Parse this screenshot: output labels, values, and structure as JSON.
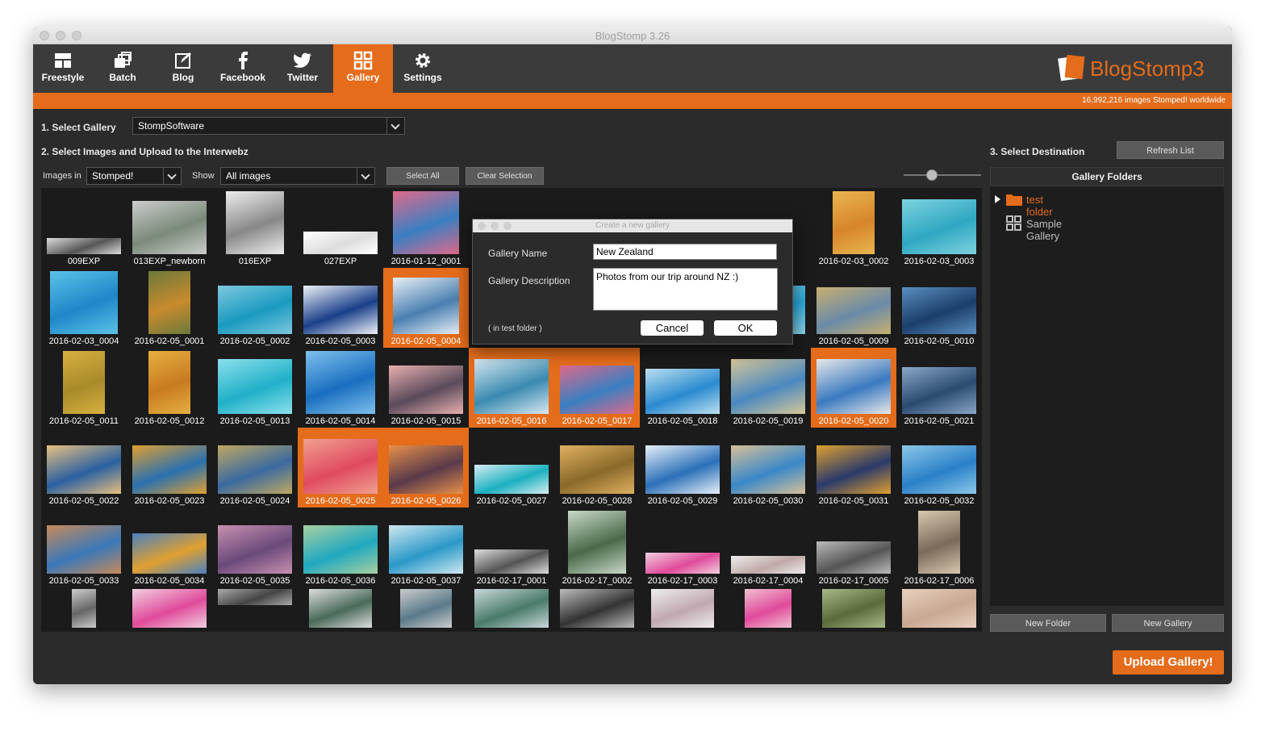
{
  "window": {
    "title": "BlogStomp 3.26"
  },
  "toolbar": {
    "items": [
      {
        "label": "Freestyle",
        "icon": "freestyle-icon"
      },
      {
        "label": "Batch",
        "icon": "batch-icon"
      },
      {
        "label": "Blog",
        "icon": "blog-icon"
      },
      {
        "label": "Facebook",
        "icon": "facebook-icon"
      },
      {
        "label": "Twitter",
        "icon": "twitter-icon"
      },
      {
        "label": "Gallery",
        "icon": "gallery-icon"
      },
      {
        "label": "Settings",
        "icon": "gear-icon"
      }
    ],
    "active": "Gallery",
    "brand": "BlogStomp3"
  },
  "status": {
    "counter": "16,992,216 images Stomped! worldwide"
  },
  "step1": {
    "label": "1. Select Gallery",
    "value": "StompSoftware"
  },
  "step2": {
    "label": "2. Select Images and Upload to the Interwebz",
    "images_in_label": "Images in",
    "images_in_value": "Stomped!",
    "show_label": "Show",
    "show_value": "All images",
    "select_all": "Select All",
    "clear_selection": "Clear Selection"
  },
  "step3": {
    "label": "3. Select Destination",
    "refresh": "Refresh List",
    "panel_title": "Gallery Folders",
    "folders": [
      {
        "name": "test folder",
        "type": "folder",
        "color": "#e46c1a"
      },
      {
        "name": "Sample Gallery",
        "type": "gallery",
        "color": "#bdbdbd"
      }
    ],
    "new_folder": "New Folder",
    "new_gallery": "New Gallery",
    "upload": "Upload Gallery!"
  },
  "thumbnails": [
    {
      "name": "009EXP",
      "selected": false,
      "colors": [
        "#555",
        "#ddd"
      ]
    },
    {
      "name": "013EXP_newborn",
      "selected": false,
      "colors": [
        "#7a8a7a",
        "#ccc"
      ]
    },
    {
      "name": "016EXP",
      "selected": false,
      "colors": [
        "#888",
        "#eee"
      ]
    },
    {
      "name": "027EXP",
      "selected": false,
      "colors": [
        "#ddd",
        "#fff"
      ]
    },
    {
      "name": "2016-01-12_0001",
      "selected": false,
      "colors": [
        "#3a7fc2",
        "#e06a8a"
      ]
    },
    {
      "name": "",
      "selected": false,
      "colors": [
        "#8ab6d8",
        "#e9eef2"
      ]
    },
    {
      "name": "",
      "selected": false,
      "colors": [
        "#2d5d8f",
        "#b8cde0"
      ]
    },
    {
      "name": "",
      "selected": false,
      "colors": [
        "#3f6f99",
        "#d0dbe5"
      ]
    },
    {
      "name": "",
      "selected": false,
      "colors": [
        "#d6a653",
        "#8ba05a"
      ]
    },
    {
      "name": "2016-02-03_0002",
      "selected": false,
      "colors": [
        "#d7852b",
        "#e9b550"
      ]
    },
    {
      "name": "2016-02-03_0003",
      "selected": false,
      "colors": [
        "#2fa7c2",
        "#7ed3df"
      ]
    },
    {
      "name": "2016-02-03_0004",
      "selected": false,
      "colors": [
        "#1f86c9",
        "#5bc3e8"
      ]
    },
    {
      "name": "2016-02-05_0001",
      "selected": false,
      "colors": [
        "#c88a2e",
        "#6b7a3a"
      ]
    },
    {
      "name": "2016-02-05_0002",
      "selected": false,
      "colors": [
        "#1a9ac0",
        "#7ec8de"
      ]
    },
    {
      "name": "2016-02-05_0003",
      "selected": false,
      "colors": [
        "#1a3f8a",
        "#eef2f8"
      ]
    },
    {
      "name": "2016-02-05_0004",
      "selected": true,
      "colors": [
        "#4a7fb0",
        "#e9f0f6"
      ]
    },
    {
      "name": "",
      "selected": false,
      "colors": [
        "#20a0c8",
        "#a8dce8"
      ]
    },
    {
      "name": "",
      "selected": false,
      "colors": [
        "#333",
        "#777"
      ]
    },
    {
      "name": "",
      "selected": false,
      "colors": [
        "#333",
        "#777"
      ]
    },
    {
      "name": "",
      "selected": false,
      "colors": [
        "#2ba8d8",
        "#8cd4e8"
      ]
    },
    {
      "name": "2016-02-05_0009",
      "selected": false,
      "colors": [
        "#6a8aa8",
        "#c8b070"
      ]
    },
    {
      "name": "2016-02-05_0010",
      "selected": false,
      "colors": [
        "#1c3e6a",
        "#5a8fc0"
      ]
    },
    {
      "name": "2016-02-05_0011",
      "selected": false,
      "colors": [
        "#a88a2a",
        "#d8b040"
      ]
    },
    {
      "name": "2016-02-05_0012",
      "selected": false,
      "colors": [
        "#c87a20",
        "#e6b040"
      ]
    },
    {
      "name": "2016-02-05_0013",
      "selected": false,
      "colors": [
        "#20b0c8",
        "#8ce0ec"
      ]
    },
    {
      "name": "2016-02-05_0014",
      "selected": false,
      "colors": [
        "#1a6ec0",
        "#7ec0ec"
      ]
    },
    {
      "name": "2016-02-05_0015",
      "selected": false,
      "colors": [
        "#5a4a5a",
        "#e8b0b0"
      ]
    },
    {
      "name": "2016-02-05_0016",
      "selected": true,
      "colors": [
        "#3a8ab0",
        "#d8e8f0"
      ]
    },
    {
      "name": "2016-02-05_0017",
      "selected": true,
      "colors": [
        "#3a7fc2",
        "#e06a8a"
      ]
    },
    {
      "name": "2016-02-05_0018",
      "selected": false,
      "colors": [
        "#2a8ad0",
        "#bce0f0"
      ]
    },
    {
      "name": "2016-02-05_0019",
      "selected": false,
      "colors": [
        "#4a88c0",
        "#d8c898"
      ]
    },
    {
      "name": "2016-02-05_0020",
      "selected": true,
      "colors": [
        "#3a7ac0",
        "#e8e8e8"
      ]
    },
    {
      "name": "2016-02-05_0021",
      "selected": false,
      "colors": [
        "#2a4a70",
        "#8aa8c8"
      ]
    },
    {
      "name": "2016-02-05_0022",
      "selected": false,
      "colors": [
        "#2a60a0",
        "#e8c080"
      ]
    },
    {
      "name": "2016-02-05_0023",
      "selected": false,
      "colors": [
        "#2a70b0",
        "#e0a030"
      ]
    },
    {
      "name": "2016-02-05_0024",
      "selected": false,
      "colors": [
        "#3a6aa0",
        "#c0a860"
      ]
    },
    {
      "name": "2016-02-05_0025",
      "selected": true,
      "colors": [
        "#e04a60",
        "#f0a090"
      ]
    },
    {
      "name": "2016-02-05_0026",
      "selected": true,
      "colors": [
        "#5a3a4a",
        "#e8904a"
      ]
    },
    {
      "name": "2016-02-05_0027",
      "selected": false,
      "colors": [
        "#1ab0c0",
        "#d8eef2"
      ]
    },
    {
      "name": "2016-02-05_0028",
      "selected": false,
      "colors": [
        "#8a6a2a",
        "#e0b060"
      ]
    },
    {
      "name": "2016-02-05_0029",
      "selected": false,
      "colors": [
        "#2a70b8",
        "#e8f0f8"
      ]
    },
    {
      "name": "2016-02-05_0030",
      "selected": false,
      "colors": [
        "#3a88c8",
        "#d8c098"
      ]
    },
    {
      "name": "2016-02-05_0031",
      "selected": false,
      "colors": [
        "#2a3a6a",
        "#e0a030"
      ]
    },
    {
      "name": "2016-02-05_0032",
      "selected": false,
      "colors": [
        "#2a80c8",
        "#8cc8e8"
      ]
    },
    {
      "name": "2016-02-05_0033",
      "selected": false,
      "colors": [
        "#3a78b8",
        "#c88a5a"
      ]
    },
    {
      "name": "2016-02-05_0034",
      "selected": false,
      "colors": [
        "#e0a030",
        "#4a80c0"
      ]
    },
    {
      "name": "2016-02-05_0035",
      "selected": false,
      "colors": [
        "#6a4a7a",
        "#c890b0"
      ]
    },
    {
      "name": "2016-02-05_0036",
      "selected": false,
      "colors": [
        "#20a8c0",
        "#a8d0a0"
      ]
    },
    {
      "name": "2016-02-05_0037",
      "selected": false,
      "colors": [
        "#2a98c8",
        "#d0e8f0"
      ]
    },
    {
      "name": "2016-02-17_0001",
      "selected": false,
      "colors": [
        "#555",
        "#ddd"
      ]
    },
    {
      "name": "2016-02-17_0002",
      "selected": false,
      "colors": [
        "#4a6a4a",
        "#c8d8c8"
      ]
    },
    {
      "name": "2016-02-17_0003",
      "selected": false,
      "colors": [
        "#e04a9a",
        "#f0d0e0"
      ]
    },
    {
      "name": "2016-02-17_0004",
      "selected": false,
      "colors": [
        "#c0a8a8",
        "#eee"
      ]
    },
    {
      "name": "2016-02-17_0005",
      "selected": false,
      "colors": [
        "#555",
        "#bbb"
      ]
    },
    {
      "name": "2016-02-17_0006",
      "selected": false,
      "colors": [
        "#7a6a5a",
        "#d8c8b0"
      ]
    },
    {
      "name": "",
      "selected": false,
      "colors": [
        "#666",
        "#ccc"
      ]
    },
    {
      "name": "",
      "selected": false,
      "colors": [
        "#e04a9a",
        "#f0d0e0"
      ]
    },
    {
      "name": "",
      "selected": false,
      "colors": [
        "#444",
        "#aaa"
      ]
    },
    {
      "name": "",
      "selected": false,
      "colors": [
        "#4a6a5a",
        "#ddd"
      ]
    },
    {
      "name": "",
      "selected": false,
      "colors": [
        "#5a7a8a",
        "#ccc"
      ]
    },
    {
      "name": "",
      "selected": false,
      "colors": [
        "#4a7a6a",
        "#c8d8d8"
      ]
    },
    {
      "name": "",
      "selected": false,
      "colors": [
        "#333",
        "#bbb"
      ]
    },
    {
      "name": "",
      "selected": false,
      "colors": [
        "#c0a8b0",
        "#eee"
      ]
    },
    {
      "name": "",
      "selected": false,
      "colors": [
        "#e04a9a",
        "#f0c0d0"
      ]
    },
    {
      "name": "",
      "selected": false,
      "colors": [
        "#5a6a3a",
        "#a8b888"
      ]
    },
    {
      "name": "",
      "selected": false,
      "colors": [
        "#c8a890",
        "#e8d0c0"
      ]
    }
  ],
  "dialog": {
    "title": "Create a new gallery",
    "name_label": "Gallery Name",
    "name_value": "New Zealand",
    "desc_label": "Gallery Description",
    "desc_value": "Photos from our trip around NZ :)",
    "location": "( in test folder )",
    "cancel": "Cancel",
    "ok": "OK"
  },
  "colors": {
    "accent": "#e46c1a",
    "background": "#2b2b2b"
  }
}
